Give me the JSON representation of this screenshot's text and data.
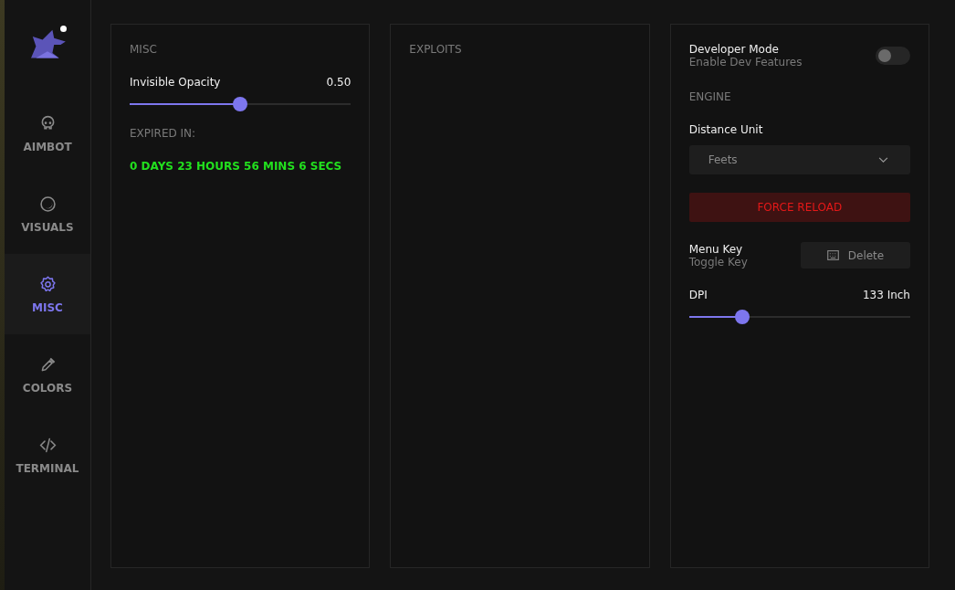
{
  "sidebar": {
    "items": [
      {
        "label": "AIMBOT",
        "selected": false
      },
      {
        "label": "VISUALS",
        "selected": false
      },
      {
        "label": "MISC",
        "selected": true
      },
      {
        "label": "COLORS",
        "selected": false
      },
      {
        "label": "TERMINAL",
        "selected": false
      }
    ]
  },
  "panels": [
    {
      "items": [
        {
          "kind": "heading",
          "text": "MISC"
        },
        {
          "kind": "slider",
          "label": "Invisible Opacity",
          "reading": "0.50",
          "level": 0.5
        },
        {
          "kind": "heading",
          "text": "EXPIRED IN:"
        },
        {
          "kind": "timer",
          "text": "0 DAYS 23 HOURS 56 MINS 6 SECS"
        }
      ]
    },
    {
      "items": [
        {
          "kind": "heading",
          "text": "EXPLOITS"
        }
      ]
    },
    {
      "items": [
        {
          "kind": "toggle",
          "label": "Developer Mode",
          "sublabel": "Enable Dev Features",
          "on": false
        },
        {
          "kind": "heading",
          "text": "ENGINE"
        },
        {
          "kind": "dropdown",
          "label": "Distance Unit",
          "value": "Feets"
        },
        {
          "kind": "button",
          "text": "FORCE RELOAD"
        },
        {
          "kind": "keybind",
          "label": "Menu Key",
          "sublabel": "Toggle Key",
          "key": "Delete"
        },
        {
          "kind": "slider",
          "label": "DPI",
          "reading": "133 Inch",
          "level": 0.24
        }
      ]
    }
  ]
}
